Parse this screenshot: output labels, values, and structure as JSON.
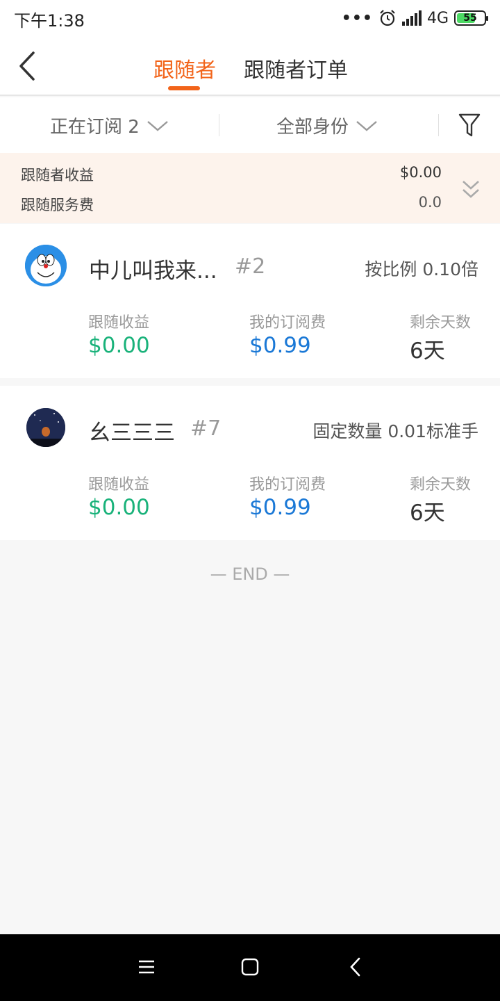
{
  "status_bar": {
    "time": "下午1:38",
    "dots": "•••",
    "network": "4G",
    "battery": "55"
  },
  "header": {
    "tabs": [
      {
        "label": "跟随者"
      },
      {
        "label": "跟随者订单"
      }
    ]
  },
  "filters": {
    "subscription": "正在订阅 2",
    "identity": "全部身份"
  },
  "summary": {
    "earnings_label": "跟随者收益",
    "earnings_value": "$0.00",
    "fee_label": "跟随服务费",
    "fee_value": "0.0"
  },
  "followers": [
    {
      "name": "中儿叫我来...",
      "number": "#2",
      "mode": "按比例 0.10倍",
      "earnings_label": "跟随收益",
      "earnings": "$0.00",
      "fee_label": "我的订阅费",
      "fee": "$0.99",
      "days_label": "剩余天数",
      "days": "6天"
    },
    {
      "name": "幺三三三",
      "number": "#7",
      "mode": "固定数量 0.01标准手",
      "earnings_label": "跟随收益",
      "earnings": "$0.00",
      "fee_label": "我的订阅费",
      "fee": "$0.99",
      "days_label": "剩余天数",
      "days": "6天"
    }
  ],
  "end_text": "— END —",
  "colors": {
    "accent": "#f2641a",
    "earnings": "#19b27a",
    "fee": "#1a78d6",
    "summary_bg": "#fdf3ec"
  }
}
